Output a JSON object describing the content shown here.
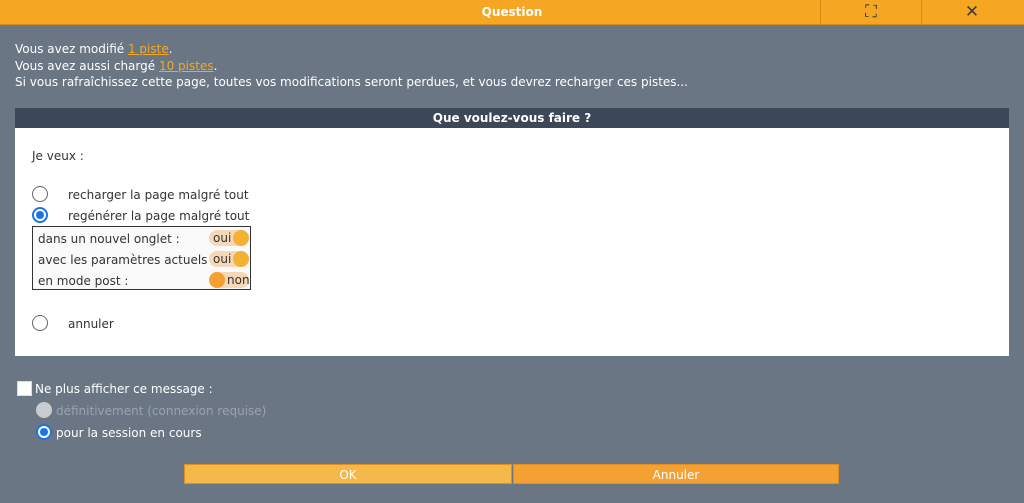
{
  "window": {
    "title": "Question",
    "maximize_glyph": "⛶",
    "close_glyph": "✕",
    "maximize_icon": "maximize-icon",
    "close_icon": "close-icon"
  },
  "message": {
    "line1_prefix": "Vous avez modifié ",
    "line1_link": "1 piste",
    "line1_suffix": ".",
    "line2_prefix": "Vous avez aussi chargé ",
    "line2_link": "10 pistes",
    "line2_suffix": ".",
    "line3": "Si vous rafraîchissez cette page, toutes vos modifications seront perdues, et vous devrez recharger ces pistes..."
  },
  "panel": {
    "header": "Que voulez-vous faire ?",
    "intro": "Je veux :",
    "choices": [
      {
        "label": "recharger la page malgré tout",
        "selected": false
      },
      {
        "label": "regénérer la page malgré tout",
        "selected": true
      },
      {
        "label": "annuler",
        "selected": false
      }
    ],
    "options": [
      {
        "label": "dans un nouvel onglet :",
        "value": "oui"
      },
      {
        "label": "avec les paramètres actuels :",
        "value": "oui"
      },
      {
        "label": "en mode post :",
        "value": "non"
      }
    ]
  },
  "dont_show": {
    "label": "Ne plus afficher ce message :",
    "choices": [
      {
        "label": "définitivement (connexion requise)",
        "selected": false,
        "disabled": true
      },
      {
        "label": "pour la session en cours",
        "selected": true,
        "disabled": false
      }
    ]
  },
  "buttons": {
    "ok": "OK",
    "cancel": "Annuler"
  },
  "colors": {
    "accent": "#f5a623",
    "header": "#3b4858",
    "background": "#6b7685",
    "radio": "#1a73e8"
  }
}
